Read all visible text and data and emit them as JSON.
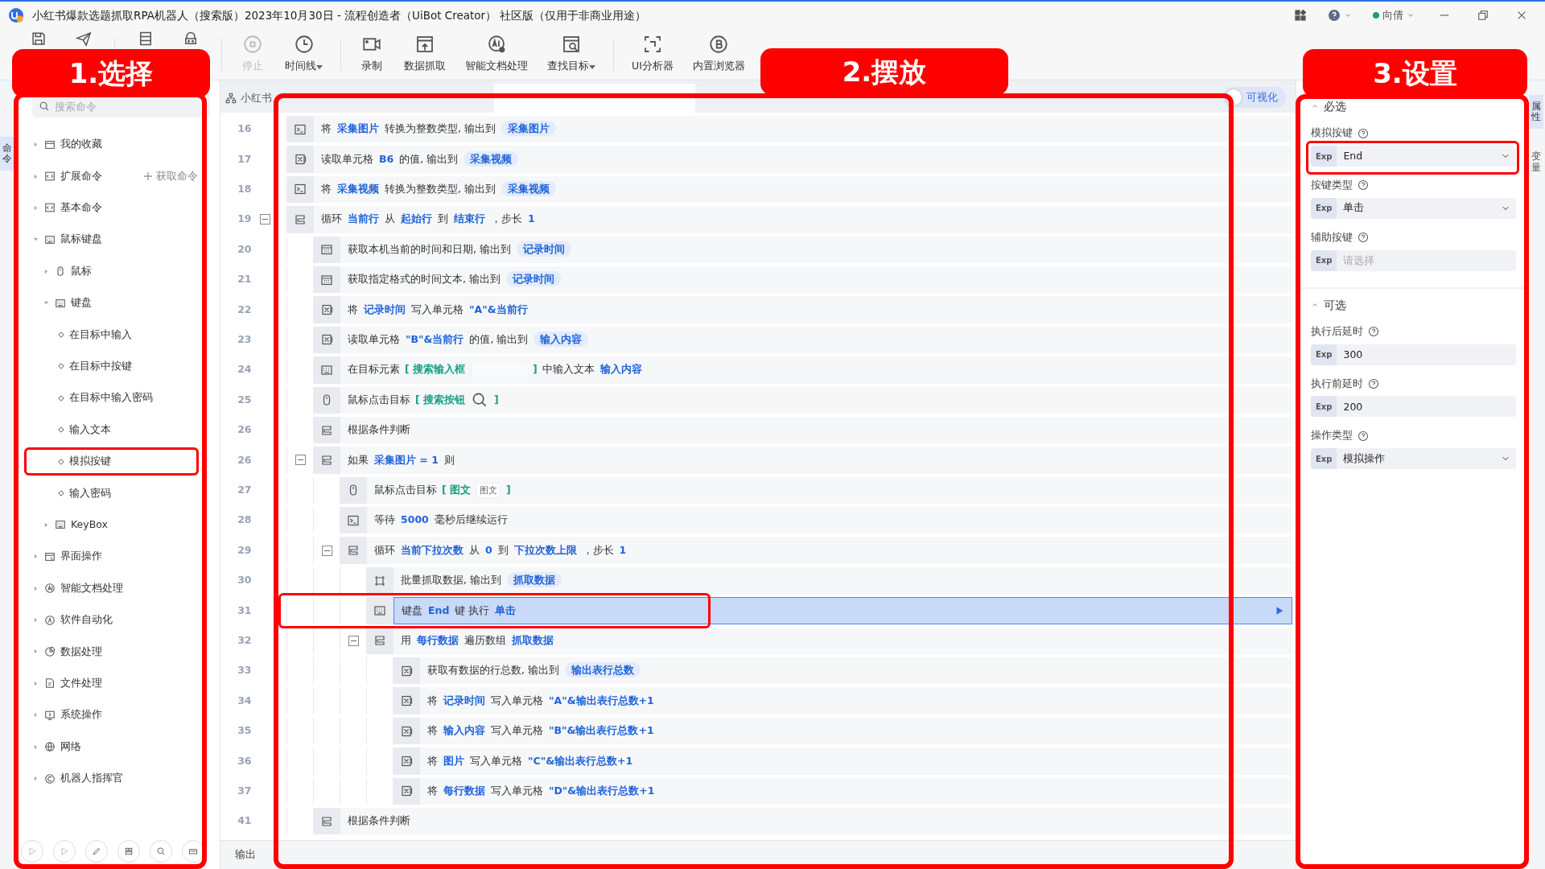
{
  "window": {
    "title": "小红书爆款选题抓取RPA机器人（搜索版）2023年10月30日 - 流程创造者（UiBot Creator） 社区版（仅用于非商业用途）"
  },
  "title_bar": {
    "user": "向倩"
  },
  "toolbar": [
    {
      "disabled": false
    },
    {
      "disabled": false
    },
    {
      "disabled": false
    },
    {
      "disabled": false
    },
    {
      "label": "停止",
      "disabled": true,
      "dropdown": false
    },
    {
      "label": "时间线",
      "disabled": false,
      "dropdown": true
    },
    {
      "label": "录制",
      "disabled": false,
      "dropdown": false
    },
    {
      "label": "数据抓取",
      "disabled": false,
      "dropdown": false
    },
    {
      "label": "智能文档处理",
      "disabled": false,
      "dropdown": false
    },
    {
      "label": "查找目标",
      "disabled": false,
      "dropdown": true
    },
    {
      "label": "UI分析器",
      "disabled": false,
      "dropdown": false
    },
    {
      "label": "内置浏览器",
      "disabled": false,
      "dropdown": false
    }
  ],
  "left_strip": [
    {
      "label": "命令",
      "selected": true
    }
  ],
  "right_strip": [
    {
      "label": "属性",
      "selected": true
    },
    {
      "label": "变量",
      "selected": false
    }
  ],
  "sidebar": {
    "search": {
      "placeholder": "搜索命令"
    },
    "tree": [
      {
        "label": "我的收藏",
        "expanded": false
      },
      {
        "label": "扩展命令",
        "expanded": false,
        "action": "获取命令"
      },
      {
        "label": "基本命令",
        "expanded": false
      },
      {
        "label": "鼠标键盘",
        "expanded": true,
        "children": [
          {
            "label": "鼠标",
            "expanded": false
          },
          {
            "label": "键盘",
            "expanded": true,
            "children": [
              {
                "label": "在目标中输入",
                "annotated": false
              },
              {
                "label": "在目标中按键",
                "annotated": false
              },
              {
                "label": "在目标中输入密码",
                "annotated": false
              },
              {
                "label": "输入文本",
                "annotated": false
              },
              {
                "label": "模拟按键",
                "annotated": true
              },
              {
                "label": "输入密码",
                "annotated": false
              }
            ]
          },
          {
            "label": "KeyBox",
            "expanded": false
          }
        ]
      },
      {
        "label": "界面操作",
        "expanded": false
      },
      {
        "label": "智能文档处理",
        "expanded": false
      },
      {
        "label": "软件自动化",
        "expanded": false
      },
      {
        "label": "数据处理",
        "expanded": false
      },
      {
        "label": "文件处理",
        "expanded": false
      },
      {
        "label": "系统操作",
        "expanded": false
      },
      {
        "label": "网络",
        "expanded": false
      },
      {
        "label": "机器人指挥官",
        "expanded": false
      }
    ]
  },
  "editor": {
    "tabs": [
      {
        "label": "小红书",
        "selected": false
      },
      {
        "selected": true
      }
    ],
    "visual_toggle": {
      "label": "可视化",
      "on": false
    },
    "rows": [
      {
        "line": "16",
        "kind": "convert",
        "selected": false,
        "annotated": false,
        "parts": [
          {
            "t": "将"
          },
          {
            "t": "采集图片",
            "kind": "var"
          },
          {
            "t": "转换为整数类型, 输出到"
          },
          {
            "t": "采集图片",
            "kind": "pill"
          }
        ]
      },
      {
        "line": "17",
        "kind": "excel",
        "selected": false,
        "annotated": false,
        "parts": [
          {
            "t": "读取单元格"
          },
          {
            "t": "B6",
            "kind": "var"
          },
          {
            "t": "的值, 输出到"
          },
          {
            "t": "采集视频",
            "kind": "pill"
          }
        ]
      },
      {
        "line": "18",
        "kind": "convert",
        "selected": false,
        "annotated": false,
        "parts": [
          {
            "t": "将"
          },
          {
            "t": "采集视频",
            "kind": "var"
          },
          {
            "t": "转换为整数类型, 输出到"
          },
          {
            "t": "采集视频",
            "kind": "pill"
          }
        ]
      },
      {
        "line": "19",
        "kind": "loop",
        "selected": false,
        "annotated": false,
        "expanded": true,
        "parts": [
          {
            "t": "循环"
          },
          {
            "t": "当前行",
            "kind": "var"
          },
          {
            "t": "从"
          },
          {
            "t": "起始行",
            "kind": "var"
          },
          {
            "t": "到"
          },
          {
            "t": "结束行",
            "kind": "var"
          },
          {
            "t": "，步长"
          },
          {
            "t": "1",
            "kind": "var"
          }
        ],
        "children": [
          {
            "line": "20",
            "kind": "calendar",
            "selected": false,
            "annotated": false,
            "parts": [
              {
                "t": "获取本机当前的时间和日期, 输出到"
              },
              {
                "t": "记录时间",
                "kind": "pill"
              }
            ]
          },
          {
            "line": "21",
            "kind": "calendar",
            "selected": false,
            "annotated": false,
            "parts": [
              {
                "t": "获取指定格式的时间文本, 输出到"
              },
              {
                "t": "记录时间",
                "kind": "pill"
              }
            ]
          },
          {
            "line": "22",
            "kind": "excel",
            "selected": false,
            "annotated": false,
            "parts": [
              {
                "t": "将"
              },
              {
                "t": "记录时间",
                "kind": "var"
              },
              {
                "t": "写入单元格"
              },
              {
                "t": "\"A\"&当前行",
                "kind": "var"
              }
            ]
          },
          {
            "line": "23",
            "kind": "excel",
            "selected": false,
            "annotated": false,
            "parts": [
              {
                "t": "读取单元格"
              },
              {
                "t": "\"B\"&当前行",
                "kind": "var"
              },
              {
                "t": "的值, 输出到"
              },
              {
                "t": "输入内容",
                "kind": "pill"
              }
            ]
          },
          {
            "line": "24",
            "kind": "keyboard",
            "selected": false,
            "annotated": false,
            "parts": [
              {
                "t": "在目标元素"
              },
              {
                "t": "[ 搜索输入框",
                "kind": "target"
              },
              {
                "kind": "thumb-blank"
              },
              {
                "t": "]",
                "kind": "target"
              },
              {
                "t": "中输入文本"
              },
              {
                "t": "输入内容",
                "kind": "var"
              }
            ]
          },
          {
            "line": "25",
            "kind": "mouse",
            "selected": false,
            "annotated": false,
            "parts": [
              {
                "t": "鼠标点击目标"
              },
              {
                "t": "[ 搜索按钮",
                "kind": "target"
              },
              {
                "kind": "thumb-search"
              },
              {
                "t": "]",
                "kind": "target"
              }
            ]
          },
          {
            "line": "26",
            "kind": "loop",
            "selected": false,
            "annotated": false,
            "parts": [
              {
                "t": "根据条件判断"
              }
            ]
          },
          {
            "line": "26",
            "kind": "loop",
            "selected": false,
            "annotated": false,
            "expanded": true,
            "parts": [
              {
                "t": "如果"
              },
              {
                "t": "采集图片 = 1",
                "kind": "var"
              },
              {
                "t": "则"
              }
            ],
            "children": [
              {
                "line": "27",
                "kind": "mouse",
                "selected": false,
                "annotated": false,
                "parts": [
                  {
                    "t": "鼠标点击目标"
                  },
                  {
                    "t": "[ 图文",
                    "kind": "target"
                  },
                  {
                    "t": "图文",
                    "kind": "thumb"
                  },
                  {
                    "t": "]",
                    "kind": "target"
                  }
                ]
              },
              {
                "line": "28",
                "kind": "convert",
                "selected": false,
                "annotated": false,
                "parts": [
                  {
                    "t": "等待"
                  },
                  {
                    "t": "5000",
                    "kind": "var"
                  },
                  {
                    "t": "毫秒后继续运行"
                  }
                ]
              },
              {
                "line": "29",
                "kind": "loop",
                "selected": false,
                "annotated": false,
                "expanded": true,
                "parts": [
                  {
                    "t": "循环"
                  },
                  {
                    "t": "当前下拉次数",
                    "kind": "var"
                  },
                  {
                    "t": "从"
                  },
                  {
                    "t": "0",
                    "kind": "var"
                  },
                  {
                    "t": "到"
                  },
                  {
                    "t": "下拉次数上限",
                    "kind": "var"
                  },
                  {
                    "t": "，步长"
                  },
                  {
                    "t": "1",
                    "kind": "var"
                  }
                ],
                "children": [
                  {
                    "line": "30",
                    "kind": "scrape",
                    "selected": false,
                    "annotated": false,
                    "parts": [
                      {
                        "t": "批量抓取数据, 输出到"
                      },
                      {
                        "t": "抓取数据",
                        "kind": "pill"
                      }
                    ]
                  },
                  {
                    "line": "31",
                    "kind": "keyboard",
                    "selected": true,
                    "annotated": true,
                    "parts": [
                      {
                        "t": "键盘"
                      },
                      {
                        "t": "End",
                        "kind": "var"
                      },
                      {
                        "t": "键 执行"
                      },
                      {
                        "t": "单击",
                        "kind": "var"
                      }
                    ]
                  },
                  {
                    "line": "32",
                    "kind": "loop",
                    "selected": false,
                    "annotated": false,
                    "expanded": true,
                    "parts": [
                      {
                        "t": "用"
                      },
                      {
                        "t": "每行数据",
                        "kind": "var"
                      },
                      {
                        "t": "遍历数组"
                      },
                      {
                        "t": "抓取数据",
                        "kind": "var"
                      }
                    ],
                    "children": [
                      {
                        "line": "33",
                        "kind": "excel",
                        "selected": false,
                        "annotated": false,
                        "parts": [
                          {
                            "t": "获取有数据的行总数, 输出到"
                          },
                          {
                            "t": "输出表行总数",
                            "kind": "pill"
                          }
                        ]
                      },
                      {
                        "line": "34",
                        "kind": "excel",
                        "selected": false,
                        "annotated": false,
                        "parts": [
                          {
                            "t": "将"
                          },
                          {
                            "t": "记录时间",
                            "kind": "var"
                          },
                          {
                            "t": "写入单元格"
                          },
                          {
                            "t": "\"A\"&输出表行总数+1",
                            "kind": "var"
                          }
                        ]
                      },
                      {
                        "line": "35",
                        "kind": "excel",
                        "selected": false,
                        "annotated": false,
                        "parts": [
                          {
                            "t": "将"
                          },
                          {
                            "t": "输入内容",
                            "kind": "var"
                          },
                          {
                            "t": "写入单元格"
                          },
                          {
                            "t": "\"B\"&输出表行总数+1",
                            "kind": "var"
                          }
                        ]
                      },
                      {
                        "line": "36",
                        "kind": "excel",
                        "selected": false,
                        "annotated": false,
                        "parts": [
                          {
                            "t": "将"
                          },
                          {
                            "t": "图片",
                            "kind": "var"
                          },
                          {
                            "t": "写入单元格"
                          },
                          {
                            "t": "\"C\"&输出表行总数+1",
                            "kind": "var"
                          }
                        ]
                      },
                      {
                        "line": "37",
                        "kind": "excel",
                        "selected": false,
                        "annotated": false,
                        "parts": [
                          {
                            "t": "将"
                          },
                          {
                            "t": "每行数据",
                            "kind": "var"
                          },
                          {
                            "t": "写入单元格"
                          },
                          {
                            "t": "\"D\"&输出表行总数+1",
                            "kind": "var"
                          }
                        ]
                      }
                    ]
                  }
                ]
              }
            ]
          },
          {
            "line": "41",
            "kind": "loop",
            "selected": false,
            "annotated": false,
            "parts": [
              {
                "t": "根据条件判断"
              }
            ]
          }
        ]
      }
    ],
    "output_tab": "输出"
  },
  "properties": {
    "sections": [
      {
        "title": "必选",
        "expanded": true,
        "fields": [
          {
            "label": "模拟按键",
            "kind": "select",
            "prefix": "Exp",
            "value": "End",
            "annotated": true
          },
          {
            "label": "按键类型",
            "kind": "select",
            "prefix": "Exp",
            "value": "单击",
            "annotated": false
          },
          {
            "label": "辅助按键",
            "kind": "input",
            "prefix": "Exp",
            "placeholder": "请选择",
            "annotated": false
          }
        ]
      },
      {
        "title": "可选",
        "expanded": true,
        "fields": [
          {
            "label": "执行后延时",
            "kind": "input",
            "prefix": "Exp",
            "value": "300",
            "annotated": false
          },
          {
            "label": "执行前延时",
            "kind": "input",
            "prefix": "Exp",
            "value": "200",
            "annotated": false
          },
          {
            "label": "操作类型",
            "kind": "select",
            "prefix": "Exp",
            "value": "模拟操作",
            "annotated": false
          }
        ]
      }
    ]
  },
  "callouts": [
    "1.选择",
    "2.摆放",
    "3.设置"
  ]
}
